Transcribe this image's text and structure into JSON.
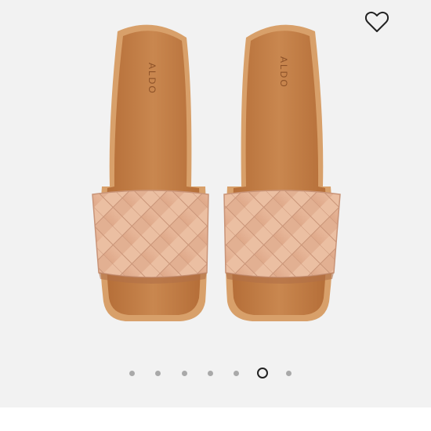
{
  "product": {
    "brand_mark": "ALDO",
    "favorite_icon": "heart-outline-icon",
    "colors": {
      "background": "#f2f2f2",
      "footbed": "#c8824a",
      "footbed_rim": "#b9733d",
      "strap": "#e8b89a",
      "strap_shadow": "#d49e82",
      "sole_edge": "#d8a06a"
    }
  },
  "carousel": {
    "total_slides": 7,
    "active_index": 5
  }
}
